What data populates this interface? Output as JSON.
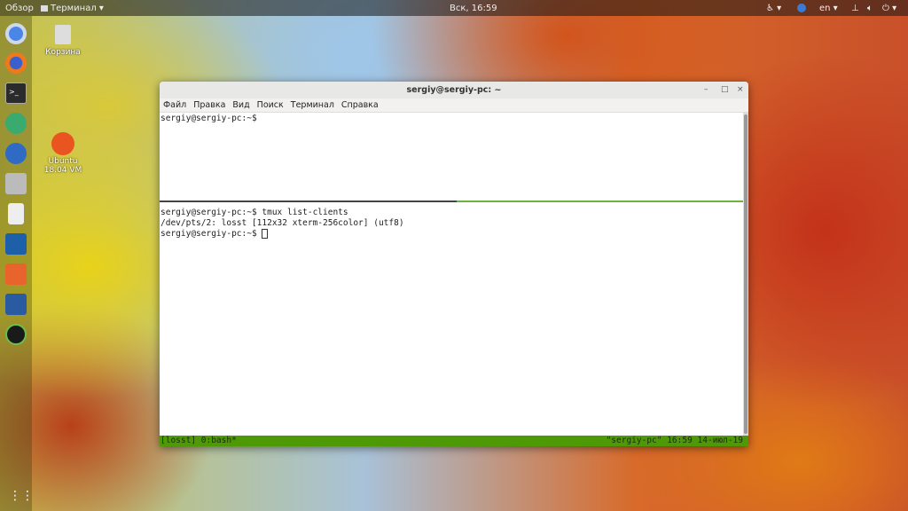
{
  "topbar": {
    "activities": "Обзор",
    "app_menu": "Терминал ▾",
    "clock": "Вск, 16:59",
    "lang": "en ▾"
  },
  "desktop": {
    "trash": "Корзина",
    "ubuntu_line1": "Ubuntu",
    "ubuntu_line2": "18.04 VM"
  },
  "window": {
    "title": "sergiy@sergiy-pc: ~",
    "minimize": "–",
    "maximize": "□",
    "close": "×",
    "menu": [
      "Файл",
      "Правка",
      "Вид",
      "Поиск",
      "Терминал",
      "Справка"
    ]
  },
  "terminal": {
    "top_pane": [
      "sergiy@sergiy-pc:~$"
    ],
    "bottom_pane": [
      "sergiy@sergiy-pc:~$ tmux list-clients",
      "/dev/pts/2: losst [112x32 xterm-256color] (utf8)",
      "sergiy@sergiy-pc:~$ "
    ],
    "status_left": "[losst] 0:bash*",
    "status_right": "\"sergiy-pc\" 16:59 14-июл-19"
  },
  "colors": {
    "tmux_green": "#4e9a06"
  }
}
